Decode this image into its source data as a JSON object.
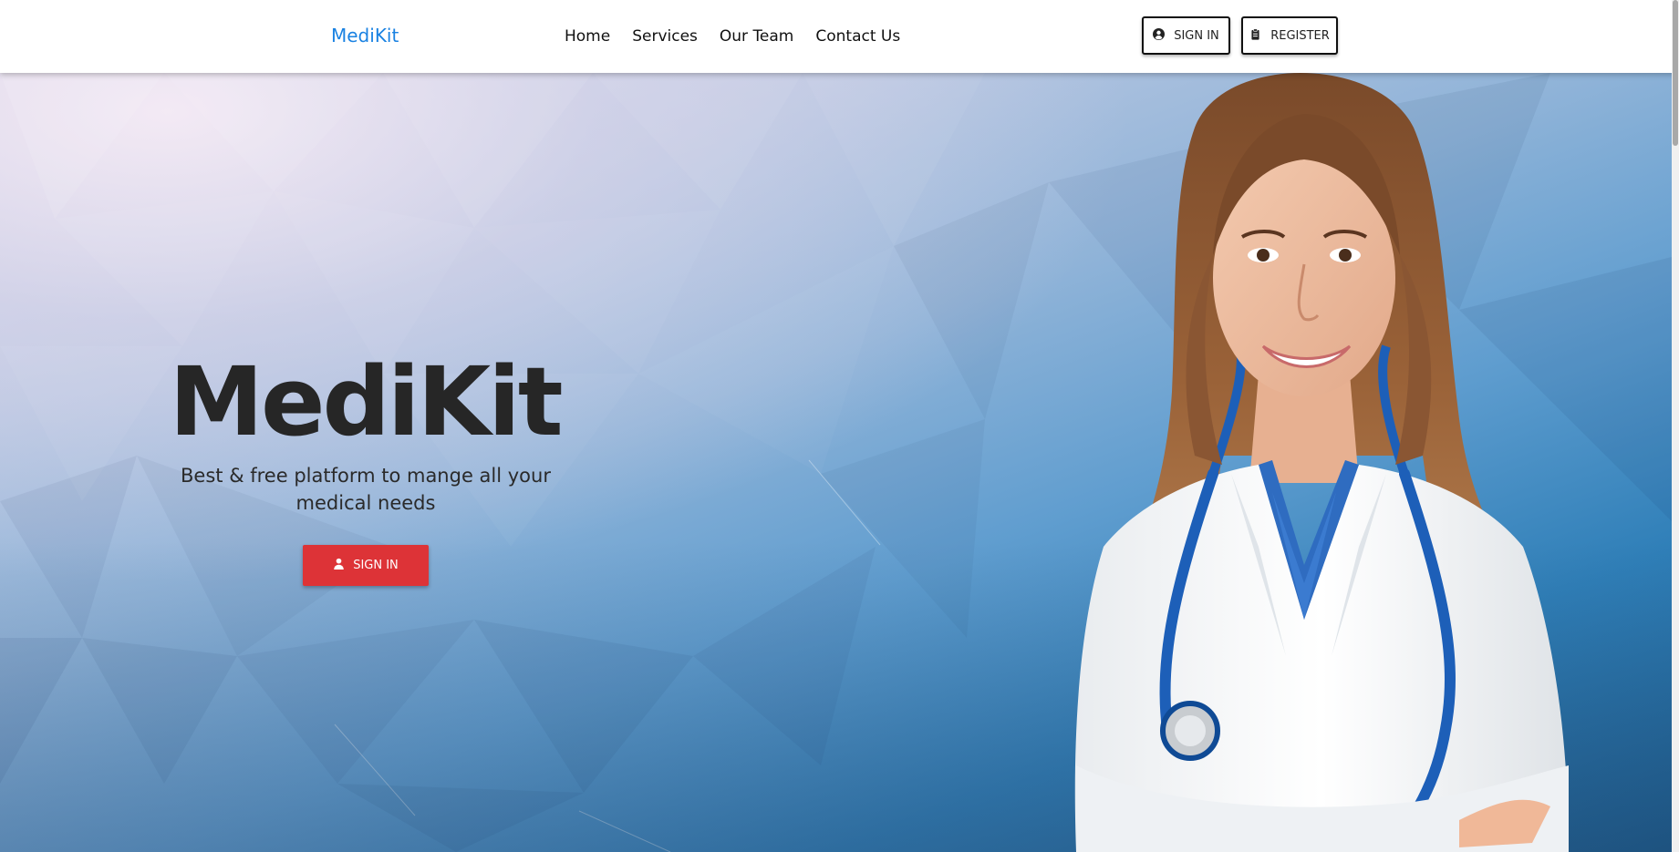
{
  "navbar": {
    "brand": "MediKit",
    "links": [
      "Home",
      "Services",
      "Our Team",
      "Contact Us"
    ],
    "signin_label": "SIGN IN",
    "register_label": "REGISTER"
  },
  "hero": {
    "title": "MediKit",
    "subtitle": "Best & free platform to mange all your medical needs",
    "button_label": "SIGN IN"
  },
  "icons": {
    "signin": "user-circle-icon",
    "register": "clipboard-icon",
    "hero_button": "user-icon"
  },
  "colors": {
    "brand": "#1a82e2",
    "primary_button": "#dd3337",
    "title_text": "#262626"
  }
}
